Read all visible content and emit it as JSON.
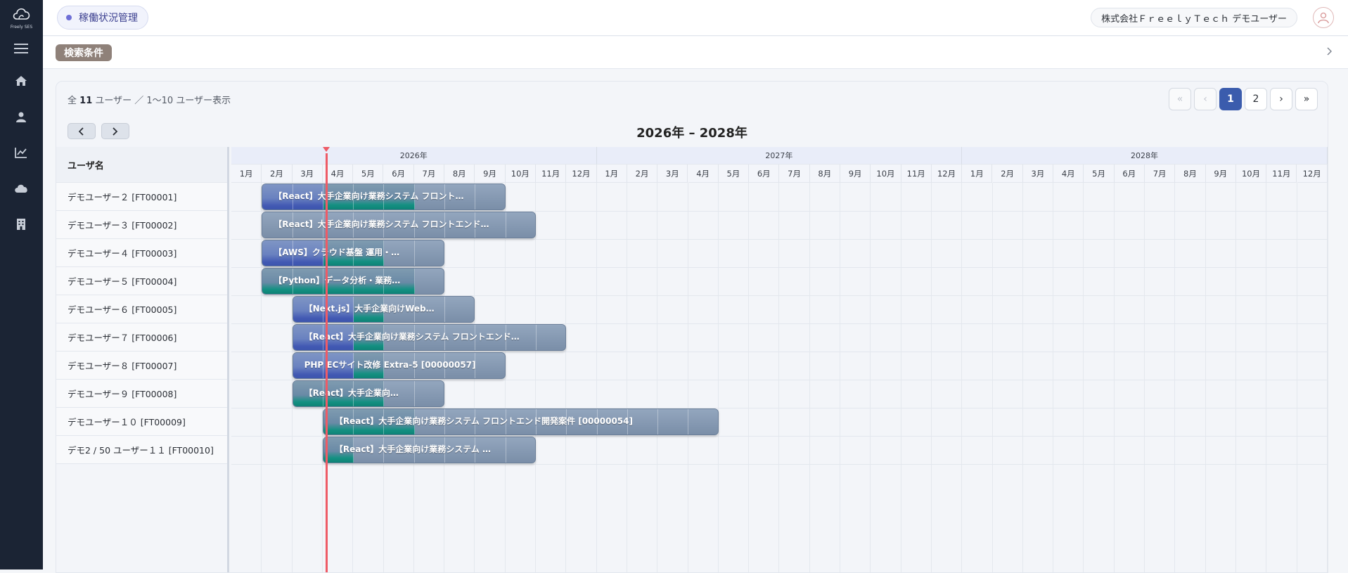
{
  "app": {
    "logo_text": "Freely SES"
  },
  "header": {
    "page_chip": "稼働状況管理",
    "user_label": "株式会社ＦｒｅｅｌｙＴｅｃｈ デモユーザー"
  },
  "sidebar": {
    "items": [
      {
        "icon": "menu-icon"
      },
      {
        "icon": "home-icon"
      },
      {
        "icon": "person-icon"
      },
      {
        "icon": "chart-icon"
      },
      {
        "icon": "cloud-icon"
      },
      {
        "icon": "building-icon"
      }
    ]
  },
  "search": {
    "label": "検索条件"
  },
  "summary": {
    "prefix": "全",
    "total": "11",
    "suffix": "ユーザー ／ 1〜10 ユーザー表示"
  },
  "pagination": {
    "first": "«",
    "prev": "‹",
    "pages": [
      "1",
      "2"
    ],
    "current": "1",
    "next": "›",
    "last": "»"
  },
  "gantt": {
    "range_title": "2026年 – 2028年",
    "name_header": "ユーザ名",
    "years": [
      "2026年",
      "2027年",
      "2028年"
    ],
    "months": [
      "1月",
      "2月",
      "3月",
      "4月",
      "5月",
      "6月",
      "7月",
      "8月",
      "9月",
      "10月",
      "11月",
      "12月"
    ],
    "today": {
      "year": 2026,
      "month": 3,
      "fraction_of_month": 0.1
    },
    "colors": {
      "blue": "#4259b3",
      "teal": "#0e8276",
      "gray": "#8194ad",
      "today": "#ee5b66"
    },
    "rows": [
      {
        "name": "デモユーザー２ [FT00001]",
        "bar": {
          "start": 2,
          "end": 9,
          "label": "【React】大手企業向け業務システム フロント…",
          "segments": [
            "blue",
            "blue",
            "teal",
            "teal",
            "teal",
            "gray",
            "gray",
            "gray"
          ]
        }
      },
      {
        "name": "デモユーザー３ [FT00002]",
        "bar": {
          "start": 2,
          "end": 10,
          "label": "【React】大手企業向け業務システム フロントエンド…",
          "segments": [
            "gray",
            "gray",
            "gray",
            "gray",
            "gray",
            "gray",
            "gray",
            "gray",
            "gray"
          ]
        }
      },
      {
        "name": "デモユーザー４ [FT00003]",
        "bar": {
          "start": 2,
          "end": 7,
          "label": "【AWS】クラウド基盤 運用・…",
          "segments": [
            "blue",
            "blue",
            "teal",
            "teal",
            "gray",
            "gray"
          ]
        }
      },
      {
        "name": "デモユーザー５ [FT00004]",
        "bar": {
          "start": 2,
          "end": 7,
          "label": "【Python】データ分析・業務…",
          "segments": [
            "teal",
            "teal",
            "teal",
            "teal",
            "teal",
            "gray"
          ]
        }
      },
      {
        "name": "デモユーザー６ [FT00005]",
        "bar": {
          "start": 3,
          "end": 8,
          "label": "【Next.js】大手企業向けWeb…",
          "segments": [
            "blue",
            "blue",
            "teal",
            "gray",
            "gray",
            "gray"
          ]
        }
      },
      {
        "name": "デモユーザー７ [FT00006]",
        "bar": {
          "start": 3,
          "end": 11,
          "label": "【React】大手企業向け業務システム フロントエンド…",
          "segments": [
            "blue",
            "blue",
            "teal",
            "gray",
            "gray",
            "gray",
            "gray",
            "gray",
            "gray"
          ]
        }
      },
      {
        "name": "デモユーザー８ [FT00007]",
        "bar": {
          "start": 3,
          "end": 9,
          "label": "PHP ECサイト改修 Extra-5 [00000057]",
          "segments": [
            "blue",
            "blue",
            "teal",
            "gray",
            "gray",
            "gray",
            "gray"
          ]
        }
      },
      {
        "name": "デモユーザー９ [FT00008]",
        "bar": {
          "start": 3,
          "end": 7,
          "label": "【React】大手企業向…",
          "segments": [
            "teal",
            "teal",
            "teal",
            "gray",
            "gray"
          ]
        }
      },
      {
        "name": "デモユーザー１０ [FT00009]",
        "bar": {
          "start": 4,
          "end": 16,
          "label": "【React】大手企業向け業務システム フロントエンド開発案件 [00000054]",
          "segments": [
            "teal",
            "teal",
            "teal",
            "gray",
            "gray",
            "gray",
            "gray",
            "gray",
            "gray",
            "gray",
            "gray",
            "gray",
            "gray"
          ]
        }
      },
      {
        "name": "デモ2 / 50 ユーザー１１ [FT00010]",
        "bar": {
          "start": 4,
          "end": 10,
          "label": "【React】大手企業向け業務システム …",
          "segments": [
            "teal",
            "gray",
            "gray",
            "gray",
            "gray",
            "gray",
            "gray"
          ]
        }
      }
    ]
  }
}
